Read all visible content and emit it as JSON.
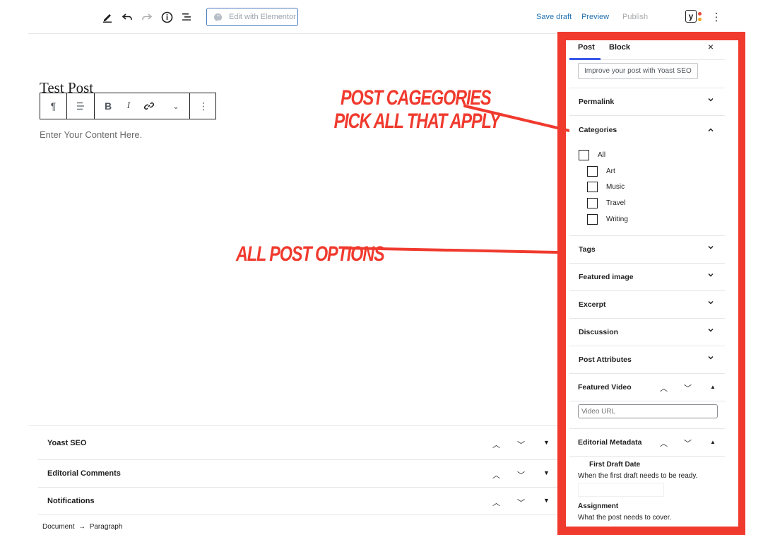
{
  "toolbar": {
    "elementor_label": "Edit with Elementor",
    "save_draft": "Save draft",
    "preview": "Preview",
    "publish": "Publish",
    "yoast_logo_letter": "y"
  },
  "editor": {
    "post_title": "Test Post",
    "content_placeholder": "Enter Your Content Here."
  },
  "annotations": {
    "categories_line1": "POST CAGEGORIES",
    "categories_line2": "PICK ALL THAT APPLY",
    "options": "ALL POST OPTIONS"
  },
  "meta_boxes": [
    {
      "label": "Yoast SEO"
    },
    {
      "label": "Editorial Comments"
    },
    {
      "label": "Notifications"
    }
  ],
  "breadcrumb": "Document  →  Paragraph",
  "sidebar": {
    "tabs": [
      {
        "label": "Post"
      },
      {
        "label": "Block"
      }
    ],
    "close": "×",
    "yoast_button": "Improve your post with Yoast SEO",
    "permalink": "Permalink",
    "categories_title": "Categories",
    "categories": [
      "All",
      "Art",
      "Music",
      "Travel",
      "Writing"
    ],
    "panels": [
      "Tags",
      "Featured image",
      "Excerpt",
      "Discussion",
      "Post Attributes"
    ],
    "featured_video": "Featured Video",
    "video_url_placeholder": "Video URL",
    "editorial_metadata": "Editorial Metadata",
    "first_draft_label": "First Draft Date",
    "first_draft_desc": "When the first draft needs to be ready.",
    "assignment_label": "Assignment",
    "assignment_desc": "What the post needs to cover."
  },
  "colors": {
    "accent_blue": "#3858e9",
    "annotation_red": "#f03a2e",
    "elementor_border": "#4a7dc0"
  }
}
